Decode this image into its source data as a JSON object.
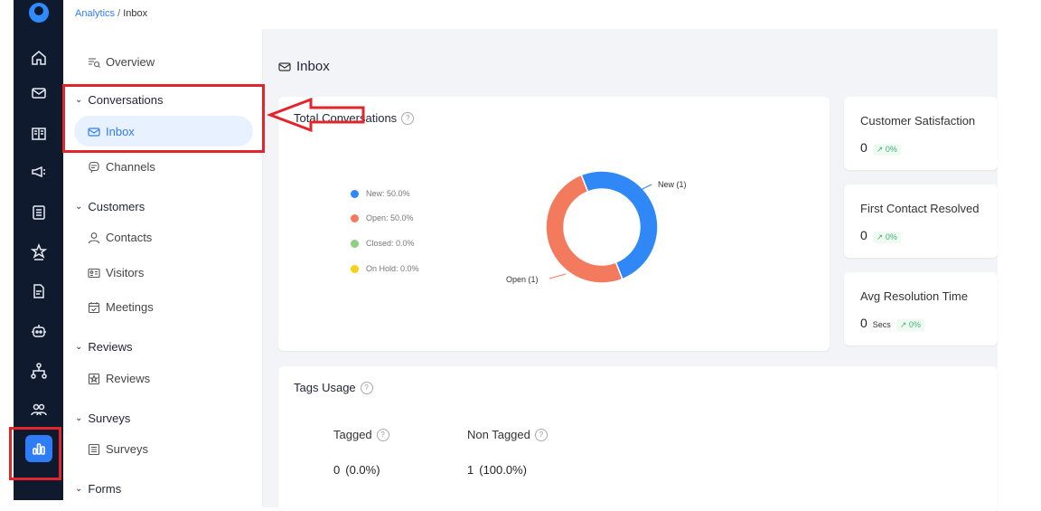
{
  "breadcrumb": {
    "parent": "Analytics",
    "separator": " / ",
    "current": "Inbox"
  },
  "rail": {
    "icons": [
      "home-icon",
      "mail-icon",
      "book-icon",
      "megaphone-icon",
      "checklist-icon",
      "award-icon",
      "document-icon",
      "bot-icon",
      "org-chart-icon",
      "team-icon",
      "analytics-icon"
    ],
    "active": "analytics-icon",
    "accent": "#2f7df6",
    "background": "#0f1a2e"
  },
  "sidebar": {
    "overview": "Overview",
    "groups": [
      {
        "label": "Conversations",
        "items": [
          "Inbox",
          "Channels"
        ]
      },
      {
        "label": "Customers",
        "items": [
          "Contacts",
          "Visitors",
          "Meetings"
        ]
      },
      {
        "label": "Reviews",
        "items": [
          "Reviews"
        ]
      },
      {
        "label": "Surveys",
        "items": [
          "Surveys"
        ]
      },
      {
        "label": "Forms",
        "items": []
      }
    ],
    "active_item": "Inbox"
  },
  "page": {
    "title": "Inbox"
  },
  "total_conversations": {
    "title": "Total Conversations",
    "help": "?",
    "legend": [
      "New: 50.0%",
      "Open: 50.0%",
      "Closed: 0.0%",
      "On Hold: 0.0%"
    ],
    "labels": {
      "new": "New (1)",
      "open": "Open (1)"
    },
    "colors": {
      "new": "#2f88f5",
      "open": "#f47a5e",
      "closed": "#8ed081",
      "on_hold": "#f7d117"
    }
  },
  "chart_data": {
    "type": "pie",
    "title": "Total Conversations",
    "categories": [
      "New",
      "Open",
      "Closed",
      "On Hold"
    ],
    "values": [
      1,
      1,
      0,
      0
    ],
    "percentages": [
      50.0,
      50.0,
      0.0,
      0.0
    ],
    "donut": true,
    "legend_position": "left"
  },
  "stats": [
    {
      "title": "Customer Satisfaction",
      "value": "0",
      "unit": "",
      "change": "↗ 0%"
    },
    {
      "title": "First Contact Resolved",
      "value": "0",
      "unit": "",
      "change": "↗ 0%"
    },
    {
      "title": "Avg Resolution Time",
      "value": "0",
      "unit": "Secs",
      "change": "↗ 0%"
    }
  ],
  "tags_usage": {
    "title": "Tags Usage",
    "tagged_label": "Tagged",
    "non_tagged_label": "Non Tagged",
    "tagged_value": "0",
    "tagged_pct": "(0.0%)",
    "non_tagged_value": "1",
    "non_tagged_pct": "(100.0%)"
  },
  "annotation_color": "#e2252b"
}
